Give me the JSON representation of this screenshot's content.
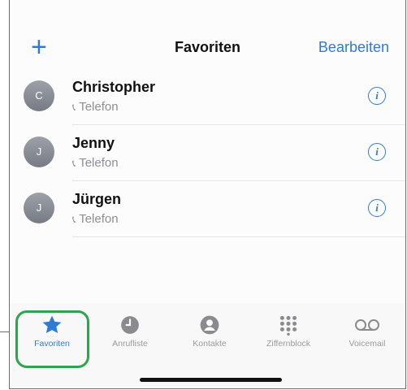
{
  "nav": {
    "add_label": "+",
    "title": "Favoriten",
    "edit_label": "Bearbeiten"
  },
  "favorites": [
    {
      "initial": "C",
      "name": "Christopher",
      "type": "Telefon"
    },
    {
      "initial": "J",
      "name": "Jenny",
      "type": "Telefon"
    },
    {
      "initial": "J",
      "name": "Jürgen",
      "type": "Telefon"
    }
  ],
  "tabs": [
    {
      "label": "Favoriten",
      "icon": "star-icon",
      "active": true
    },
    {
      "label": "Anrufliste",
      "icon": "clock-icon",
      "active": false
    },
    {
      "label": "Kontakte",
      "icon": "contact-icon",
      "active": false
    },
    {
      "label": "Ziffernblock",
      "icon": "keypad-icon",
      "active": false
    },
    {
      "label": "Voicemail",
      "icon": "voicemail-icon",
      "active": false
    }
  ],
  "colors": {
    "accent": "#2f7bd3",
    "highlight": "#2fa34d",
    "inactive": "#9a9a9f"
  }
}
